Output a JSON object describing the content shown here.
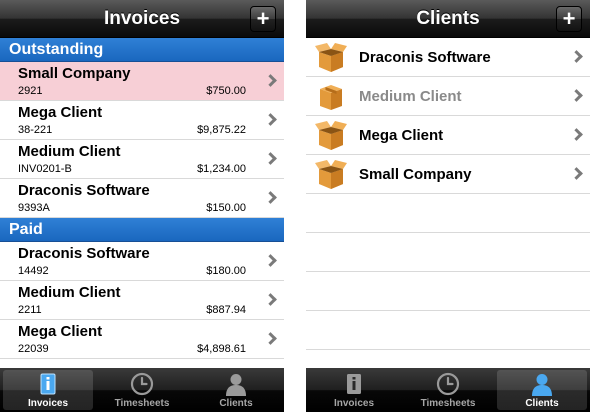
{
  "invoices_screen": {
    "title": "Invoices",
    "add_label": "+",
    "sections": [
      {
        "header": "Outstanding",
        "rows": [
          {
            "client": "Small Company",
            "number": "2921",
            "amount": "$750.00",
            "highlighted": true
          },
          {
            "client": "Mega Client",
            "number": "38-221",
            "amount": "$9,875.22"
          },
          {
            "client": "Medium Client",
            "number": "INV0201-B",
            "amount": "$1,234.00"
          },
          {
            "client": "Draconis Software",
            "number": "9393A",
            "amount": "$150.00"
          }
        ]
      },
      {
        "header": "Paid",
        "rows": [
          {
            "client": "Draconis Software",
            "number": "14492",
            "amount": "$180.00"
          },
          {
            "client": "Medium Client",
            "number": "2211",
            "amount": "$887.94"
          },
          {
            "client": "Mega Client",
            "number": "22039",
            "amount": "$4,898.61"
          }
        ]
      }
    ],
    "tabs": [
      {
        "label": "Invoices",
        "icon": "invoice-icon"
      },
      {
        "label": "Timesheets",
        "icon": "clock-icon"
      },
      {
        "label": "Clients",
        "icon": "person-icon"
      }
    ],
    "selected_tab": "Invoices"
  },
  "clients_screen": {
    "title": "Clients",
    "add_label": "+",
    "clients": [
      {
        "name": "Draconis Software",
        "icon": "open-box-icon",
        "dimmed": false
      },
      {
        "name": "Medium Client",
        "icon": "closed-box-icon",
        "dimmed": true
      },
      {
        "name": "Mega Client",
        "icon": "open-box-icon",
        "dimmed": false
      },
      {
        "name": "Small Company",
        "icon": "open-box-icon",
        "dimmed": false
      }
    ],
    "tabs": [
      {
        "label": "Invoices",
        "icon": "invoice-icon"
      },
      {
        "label": "Timesheets",
        "icon": "clock-icon"
      },
      {
        "label": "Clients",
        "icon": "person-icon"
      }
    ],
    "selected_tab": "Clients"
  },
  "colors": {
    "section_header": "#1a67bf",
    "highlight_row": "#f7cfd6",
    "box": "#e39a3b",
    "tab_selected_icon": "#4aa8f0"
  }
}
